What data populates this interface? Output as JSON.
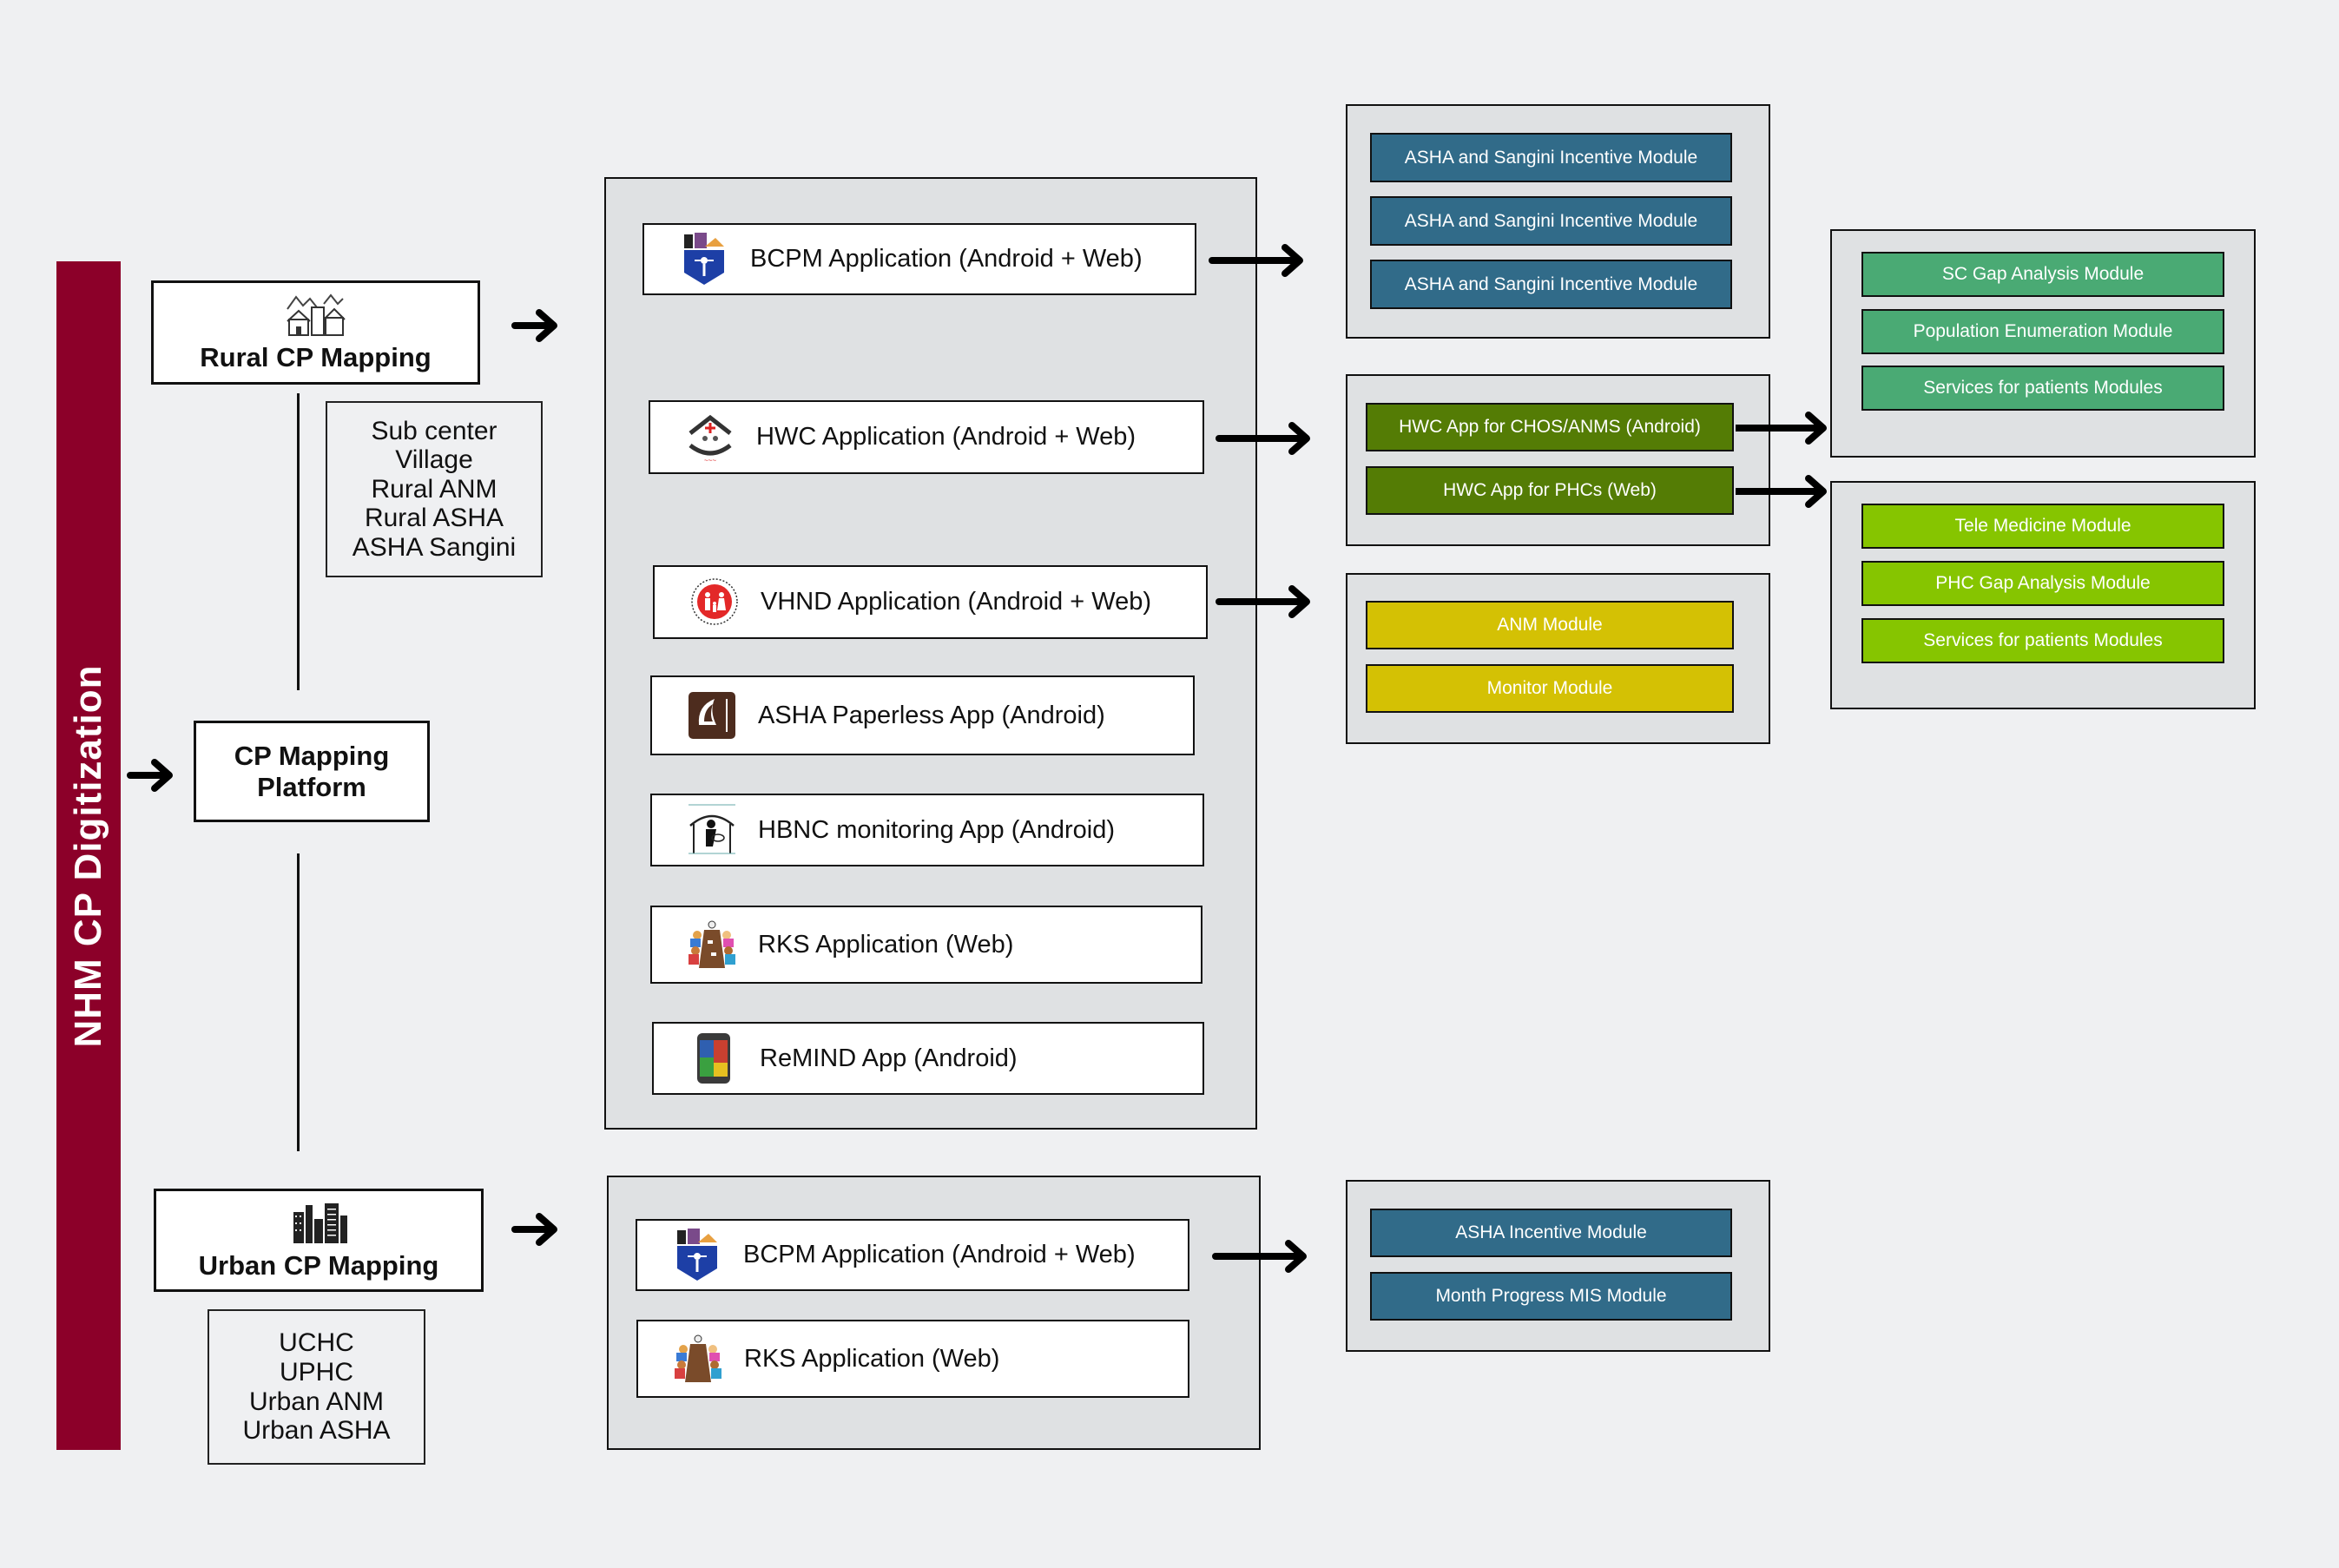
{
  "sidebar": {
    "title": "NHM CP Digitization",
    "color": "#8c0029"
  },
  "platform": {
    "title_line1": "CP Mapping",
    "title_line2": "Platform"
  },
  "rural": {
    "title": "Rural CP Mapping",
    "icon": "village-houses-icon",
    "entities": [
      "Sub center",
      "Village",
      "Rural ANM",
      "Rural ASHA",
      "ASHA Sangini"
    ]
  },
  "urban": {
    "title": "Urban CP Mapping",
    "icon": "city-buildings-icon",
    "entities": [
      "UCHC",
      "UPHC",
      "Urban ANM",
      "Urban ASHA"
    ]
  },
  "rural_apps": [
    {
      "label": "BCPM Application (Android + Web)",
      "icon": "bcpm-logo-icon"
    },
    {
      "label": "HWC Application (Android + Web)",
      "icon": "hwc-logo-icon"
    },
    {
      "label": "VHND Application (Android + Web)",
      "icon": "nhm-logo-icon"
    },
    {
      "label": "ASHA Paperless App (Android)",
      "icon": "asha-paperless-icon"
    },
    {
      "label": "HBNC monitoring App (Android)",
      "icon": "hbnc-mother-child-icon"
    },
    {
      "label": "RKS Application (Web)",
      "icon": "rks-meeting-icon"
    },
    {
      "label": "ReMIND App (Android)",
      "icon": "remind-phone-icon"
    }
  ],
  "urban_apps": [
    {
      "label": "BCPM Application (Android + Web)",
      "icon": "bcpm-logo-icon"
    },
    {
      "label": "RKS Application (Web)",
      "icon": "rks-meeting-icon"
    }
  ],
  "module_groups": {
    "bcpm_rural": {
      "color": "#316b89",
      "items": [
        "ASHA and Sangini Incentive Module",
        "ASHA and Sangini Incentive Module",
        "ASHA and Sangini Incentive Module"
      ]
    },
    "hwc": {
      "color": "#547c05",
      "items": [
        "HWC App for CHOS/ANMS (Android)",
        "HWC App for PHCs (Web)"
      ]
    },
    "vhnd": {
      "color": "#d4c104",
      "items": [
        "ANM Module",
        "Monitor Module"
      ]
    },
    "hwc_chos": {
      "color": "#4aaa74",
      "items": [
        "SC Gap Analysis Module",
        "Population Enumeration Module",
        "Services for patients Modules"
      ]
    },
    "hwc_phc": {
      "color": "#86c500",
      "items": [
        "Tele Medicine Module",
        "PHC Gap Analysis Module",
        "Services for patients Modules"
      ]
    },
    "bcpm_urban": {
      "color": "#316b89",
      "items": [
        "ASHA Incentive Module",
        "Month Progress MIS Module"
      ]
    }
  }
}
